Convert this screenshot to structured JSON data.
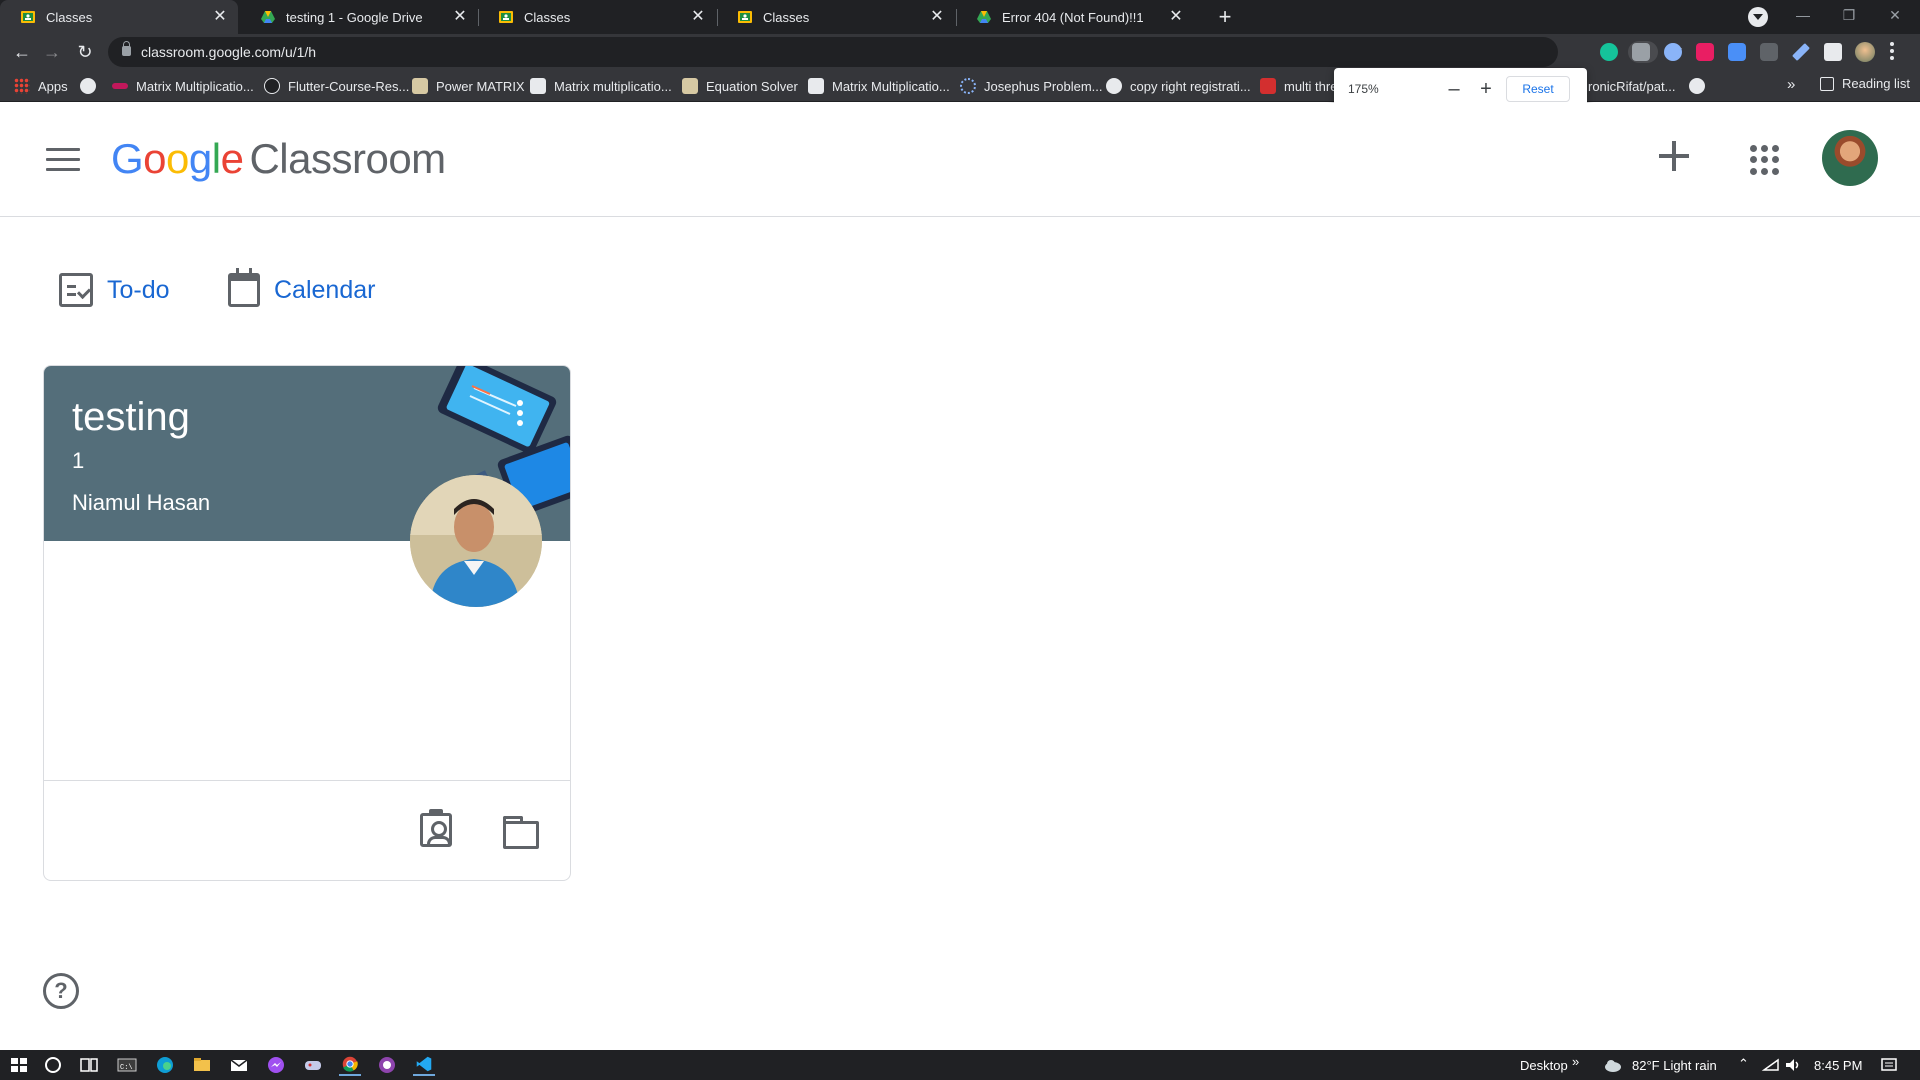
{
  "browser": {
    "tabs": [
      {
        "title": "Classes",
        "icon": "google-classroom-icon",
        "favicon_color": "#fbbc04",
        "active": true
      },
      {
        "title": "testing 1 - Google Drive",
        "icon": "google-drive-icon",
        "favicon_color": "#34a853",
        "active": false
      },
      {
        "title": "Classes",
        "icon": "google-classroom-icon",
        "favicon_color": "#fbbc04",
        "active": false
      },
      {
        "title": "Classes",
        "icon": "google-classroom-icon",
        "favicon_color": "#fbbc04",
        "active": false
      },
      {
        "title": "Error 404 (Not Found)!!1",
        "icon": "google-drive-icon",
        "favicon_color": "#4285f4",
        "active": false
      }
    ],
    "new_tab_label": "+",
    "close_glyph": "✕",
    "url": "classroom.google.com/u/1/h",
    "bookmarks": [
      {
        "label": "Apps",
        "icon": "apps-grid-icon"
      },
      {
        "label": "",
        "icon": "globe-icon"
      },
      {
        "label": "Matrix Multiplicatio...",
        "icon": "bookmark-icon"
      },
      {
        "label": "Flutter-Course-Res...",
        "icon": "github-icon"
      },
      {
        "label": "Power MATRIX",
        "icon": "bookmark-icon"
      },
      {
        "label": "Matrix multiplicatio...",
        "icon": "bookmark-icon"
      },
      {
        "label": "Equation Solver",
        "icon": "bookmark-icon"
      },
      {
        "label": "Matrix Multiplicatio...",
        "icon": "bookmark-icon"
      },
      {
        "label": "Josephus Problem...",
        "icon": "bookmark-icon"
      },
      {
        "label": "copy right registrati...",
        "icon": "globe-icon"
      },
      {
        "label": "multi thre",
        "icon": "bookmark-icon"
      },
      {
        "label": "ronicRifat/pat...",
        "icon": "github-icon"
      }
    ],
    "bookmarks_overflow": "»",
    "reading_list": "Reading list",
    "zoom_popup": {
      "level": "175%",
      "minus": "–",
      "plus": "+",
      "reset": "Reset"
    }
  },
  "header": {
    "logo_google": [
      "G",
      "o",
      "o",
      "g",
      "l",
      "e"
    ],
    "logo_product": "Classroom"
  },
  "subnav": {
    "todo_label": "To-do",
    "calendar_label": "Calendar"
  },
  "class_card": {
    "title": "testing",
    "section": "1",
    "teacher": "Niamul Hasan",
    "banner_color": "#546e7a"
  },
  "help_glyph": "?",
  "taskbar": {
    "desktop_label": "Desktop",
    "desktop_chevron": "»",
    "weather": "82°F  Light rain",
    "time": "8:45 PM"
  },
  "colors": {
    "link_blue": "#1967d2",
    "icon_grey": "#5f6368"
  }
}
